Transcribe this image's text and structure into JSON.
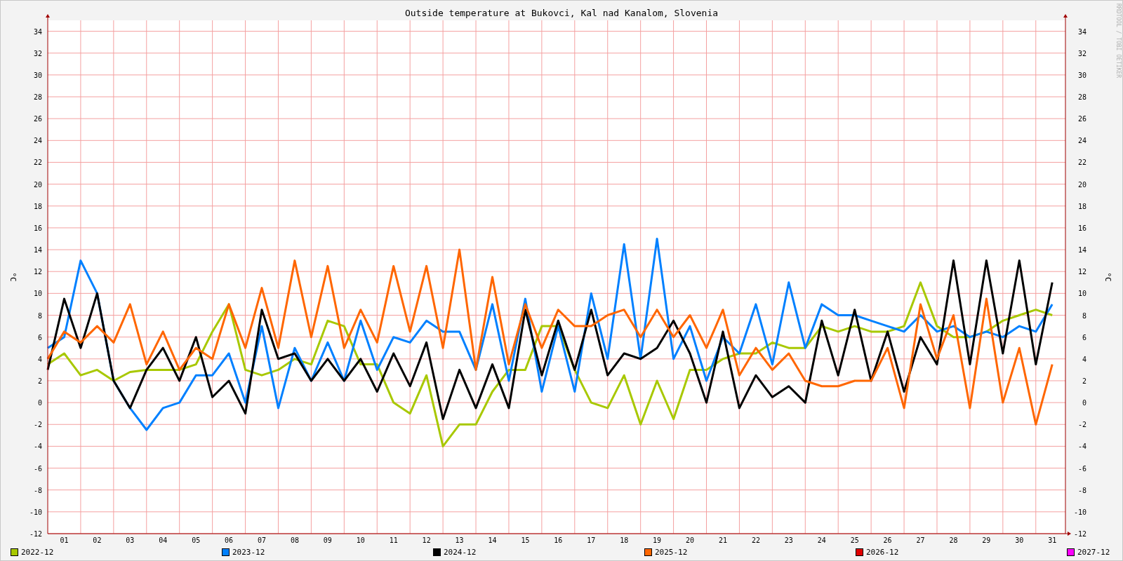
{
  "chart": {
    "ylabel_right": "°C",
    "credit": "RRDTOOL / TOBI OETIKER",
    "right_yticks": [
      "34",
      "32",
      "30",
      "28",
      "26",
      "24",
      "22",
      "20",
      "18",
      "16",
      "14",
      "12",
      "10",
      "8",
      "6",
      "4",
      "2",
      "0",
      "-2",
      "-4",
      "-6",
      "-8",
      "-10",
      "-12"
    ],
    "chart_data": {
      "type": "line",
      "title": "Outside temperature at Bukovci, Kal nad Kanalom, Slovenia",
      "ylabel": "°C",
      "xlim": [
        1,
        31.9
      ],
      "ylim": [
        -12,
        35
      ],
      "grid": true,
      "yticks": [
        {
          "value": 34,
          "label": "34"
        },
        {
          "value": 32,
          "label": "32"
        },
        {
          "value": 30,
          "label": "30"
        },
        {
          "value": 28,
          "label": "28"
        },
        {
          "value": 26,
          "label": "26"
        },
        {
          "value": 24,
          "label": "24"
        },
        {
          "value": 22,
          "label": "22"
        },
        {
          "value": 20,
          "label": "20"
        },
        {
          "value": 18,
          "label": "18"
        },
        {
          "value": 16,
          "label": "16"
        },
        {
          "value": 14,
          "label": "14"
        },
        {
          "value": 12,
          "label": "12"
        },
        {
          "value": 10,
          "label": "10"
        },
        {
          "value": 8,
          "label": "8"
        },
        {
          "value": 6,
          "label": "6"
        },
        {
          "value": 4,
          "label": "4"
        },
        {
          "value": 2,
          "label": "2"
        },
        {
          "value": 0,
          "label": "0"
        },
        {
          "value": -2,
          "label": "-2"
        },
        {
          "value": -4,
          "label": "-4"
        },
        {
          "value": -6,
          "label": "-6"
        },
        {
          "value": -8,
          "label": "-8"
        },
        {
          "value": -10,
          "label": "-10"
        },
        {
          "value": -12,
          "label": "-12"
        }
      ],
      "xticks": [
        {
          "value": 1.5,
          "label": "01"
        },
        {
          "value": 2.5,
          "label": "02"
        },
        {
          "value": 3.5,
          "label": "03"
        },
        {
          "value": 4.5,
          "label": "04"
        },
        {
          "value": 5.5,
          "label": "05"
        },
        {
          "value": 6.5,
          "label": "06"
        },
        {
          "value": 7.5,
          "label": "07"
        },
        {
          "value": 8.5,
          "label": "08"
        },
        {
          "value": 9.5,
          "label": "09"
        },
        {
          "value": 10.5,
          "label": "10"
        },
        {
          "value": 11.5,
          "label": "11"
        },
        {
          "value": 12.5,
          "label": "12"
        },
        {
          "value": 13.5,
          "label": "13"
        },
        {
          "value": 14.5,
          "label": "14"
        },
        {
          "value": 15.5,
          "label": "15"
        },
        {
          "value": 16.5,
          "label": "16"
        },
        {
          "value": 17.5,
          "label": "17"
        },
        {
          "value": 18.5,
          "label": "18"
        },
        {
          "value": 19.5,
          "label": "19"
        },
        {
          "value": 20.5,
          "label": "20"
        },
        {
          "value": 21.5,
          "label": "21"
        },
        {
          "value": 22.5,
          "label": "22"
        },
        {
          "value": 23.5,
          "label": "23"
        },
        {
          "value": 24.5,
          "label": "24"
        },
        {
          "value": 25.5,
          "label": "25"
        },
        {
          "value": 26.5,
          "label": "26"
        },
        {
          "value": 27.5,
          "label": "27"
        },
        {
          "value": 28.5,
          "label": "28"
        },
        {
          "value": 29.5,
          "label": "29"
        },
        {
          "value": 30.5,
          "label": "30"
        },
        {
          "value": 31.5,
          "label": "31"
        }
      ],
      "x": [
        1,
        1.5,
        2,
        2.5,
        3,
        3.5,
        4,
        4.5,
        5,
        5.5,
        6,
        6.5,
        7,
        7.5,
        8,
        8.5,
        9,
        9.5,
        10,
        10.5,
        11,
        11.5,
        12,
        12.5,
        13,
        13.5,
        14,
        14.5,
        15,
        15.5,
        16,
        16.5,
        17,
        17.5,
        18,
        18.5,
        19,
        19.5,
        20,
        20.5,
        21,
        21.5,
        22,
        22.5,
        23,
        23.5,
        24,
        24.5,
        25,
        25.5,
        26,
        26.5,
        27,
        27.5,
        28,
        28.5,
        29,
        29.5,
        30,
        30.5,
        31,
        31.5
      ],
      "series": [
        {
          "name": "2022-12",
          "color": "#a8c800",
          "values": [
            3.5,
            4.5,
            2.5,
            3,
            2,
            2.8,
            3,
            3,
            3,
            3.5,
            6.5,
            9,
            3,
            2.5,
            3,
            4,
            3.5,
            7.5,
            7,
            3.5,
            3.5,
            0,
            -1,
            2.5,
            -4,
            -2,
            -2,
            1,
            3,
            3,
            7,
            7,
            3,
            0,
            -0.5,
            2.5,
            -2,
            2,
            -1.5,
            3,
            3,
            4,
            4.5,
            4.5,
            5.5,
            5,
            5,
            7,
            6.5,
            7,
            6.5,
            6.5,
            7,
            11,
            7,
            6,
            6,
            6.5,
            7.5,
            8,
            8.5,
            8
          ]
        },
        {
          "name": "2023-12",
          "color": "#0080ff",
          "values": [
            5,
            6,
            13,
            10,
            2,
            -0.5,
            -2.5,
            -0.5,
            0,
            2.5,
            2.5,
            4.5,
            0,
            7,
            -0.5,
            5,
            2,
            5.5,
            2,
            7.5,
            3,
            6,
            5.5,
            7.5,
            6.5,
            6.5,
            3,
            9,
            2,
            9.5,
            1,
            7,
            1,
            10,
            4,
            14.5,
            4,
            15,
            4,
            7,
            2,
            6,
            4.5,
            9,
            3.5,
            11,
            5,
            9,
            8,
            8,
            7.5,
            7,
            6.5,
            8,
            6.5,
            7,
            6,
            6.5,
            6,
            7,
            6.5,
            9
          ]
        },
        {
          "name": "2024-12",
          "color": "#000000",
          "values": [
            3,
            9.5,
            5,
            10,
            2,
            -0.5,
            3,
            5,
            2,
            6,
            0.5,
            2,
            -1,
            8.5,
            4,
            4.5,
            2,
            4,
            2,
            4,
            1,
            4.5,
            1.5,
            5.5,
            -1.5,
            3,
            -0.5,
            3.5,
            -0.5,
            8.5,
            2.5,
            7.5,
            3,
            8.5,
            2.5,
            4.5,
            4,
            5,
            7.5,
            4.5,
            0,
            6.5,
            -0.5,
            2.5,
            0.5,
            1.5,
            0,
            7.5,
            2.5,
            8.5,
            2,
            6.5,
            1,
            6,
            3.5,
            13,
            3.5,
            13,
            4.5,
            13,
            3.5,
            11
          ]
        },
        {
          "name": "2025-12",
          "color": "#ff6600",
          "values": [
            4,
            6.5,
            5.5,
            7,
            5.5,
            9,
            3.5,
            6.5,
            3,
            5,
            4,
            9,
            5,
            10.5,
            5,
            13,
            6,
            12.5,
            5,
            8.5,
            5.5,
            12.5,
            6.5,
            12.5,
            5,
            14,
            3,
            11.5,
            3.5,
            9,
            5,
            8.5,
            7,
            7,
            8,
            8.5,
            6,
            8.5,
            6,
            8,
            5,
            8.5,
            2.5,
            5,
            3,
            4.5,
            2,
            1.5,
            1.5,
            2,
            2,
            5,
            -0.5,
            9,
            4,
            8,
            -0.5,
            9.5,
            0,
            5,
            -2,
            3.5
          ]
        },
        {
          "name": "2026-12",
          "color": "#e00000",
          "values": [
            null,
            null,
            null,
            null,
            null,
            null,
            null,
            null,
            null,
            null,
            null,
            null,
            null,
            null,
            null,
            null,
            null,
            null,
            null,
            null,
            null,
            null,
            null,
            null,
            null,
            null,
            null,
            null,
            null,
            null,
            null,
            null,
            null,
            null,
            null,
            null,
            null,
            null,
            null,
            null,
            null,
            null,
            null,
            null,
            null,
            null,
            null,
            null,
            null,
            null,
            null,
            null,
            null,
            null,
            null,
            null,
            null,
            null,
            null,
            null,
            null,
            null
          ]
        },
        {
          "name": "2027-12",
          "color": "#ff00ff",
          "values": [
            null,
            null,
            null,
            null,
            null,
            null,
            null,
            null,
            null,
            null,
            null,
            null,
            null,
            null,
            null,
            null,
            null,
            null,
            null,
            null,
            null,
            null,
            null,
            null,
            null,
            null,
            null,
            null,
            null,
            null,
            null,
            null,
            null,
            null,
            null,
            null,
            null,
            null,
            null,
            null,
            null,
            null,
            null,
            null,
            null,
            null,
            null,
            null,
            null,
            null,
            null,
            null,
            null,
            null,
            null,
            null,
            null,
            null,
            null,
            null,
            null,
            null
          ]
        }
      ]
    }
  }
}
